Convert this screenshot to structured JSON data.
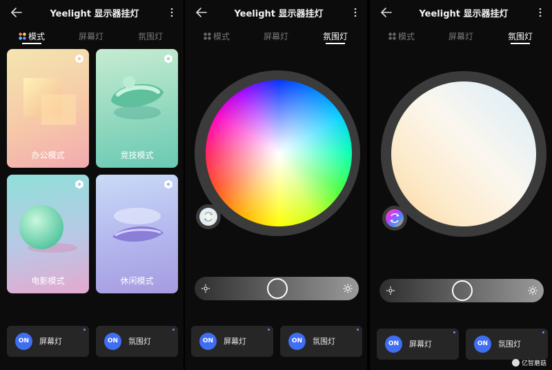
{
  "app": {
    "title": "Yeelight 显示器挂灯"
  },
  "tabs": {
    "mode": "模式",
    "screen": "屏幕灯",
    "ambient": "氛围灯"
  },
  "modes": [
    {
      "label": "办公模式"
    },
    {
      "label": "竞技模式"
    },
    {
      "label": "电影模式"
    },
    {
      "label": "休闲模式"
    }
  ],
  "power": {
    "on": "ON",
    "screen_light": "屏幕灯",
    "ambient_light": "氛围灯"
  },
  "watermark": {
    "text": "亿智蘑菇"
  },
  "colors": {
    "accent": "#3f6ef2",
    "background": "#0c0c0c",
    "button": "#262626"
  },
  "icons": [
    "back-arrow-icon",
    "more-vertical-icon",
    "mode-grid-icon",
    "gear-icon",
    "brightness-low-icon",
    "brightness-high-icon",
    "color-cycle-icon"
  ]
}
